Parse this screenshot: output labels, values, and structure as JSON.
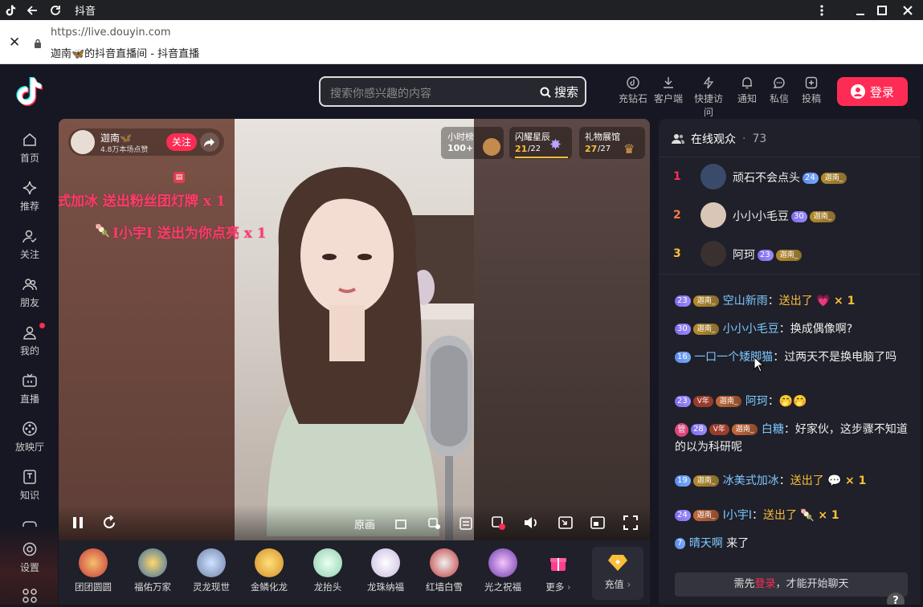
{
  "window": {
    "title": "抖音"
  },
  "urlbar": {
    "url": "https://live.douyin.com",
    "page_title": "迦南🦋的抖音直播间 - 抖音直播"
  },
  "header": {
    "search_placeholder": "搜索你感兴趣的内容",
    "search_button": "搜索",
    "items": [
      "充钻石",
      "客户端",
      "快捷访问",
      "通知",
      "私信",
      "投稿"
    ],
    "login": "登录"
  },
  "sidebar": {
    "items": [
      "首页",
      "推荐",
      "关注",
      "朋友",
      "我的",
      "直播",
      "放映厅",
      "知识",
      "设置"
    ]
  },
  "stream": {
    "anchor_name": "迦南🦋",
    "anchor_likes": "4.8万本场点赞",
    "follow": "关注",
    "hourly": {
      "label": "小时榜",
      "value": "100+"
    },
    "star": {
      "label": "闪耀星辰",
      "value": "21",
      "total": "/22"
    },
    "gallery": {
      "label": "礼物展馆",
      "value": "27",
      "total": "/27"
    },
    "float1": "式加冰 送出粉丝团灯牌 x 1",
    "float2": "I小宇I 送出为你点亮 x 1",
    "quality": "原画"
  },
  "gifts": {
    "items": [
      "团团圆圆",
      "福佑万家",
      "灵龙现世",
      "金鳞化龙",
      "龙抬头",
      "龙珠纳福",
      "红墙白雪",
      "光之祝福"
    ],
    "more": "更多",
    "recharge": "充值"
  },
  "audience": {
    "title": "在线观众",
    "count": "73",
    "ranks": [
      {
        "num": "1",
        "name": "顽石不会点头",
        "level": "24",
        "fan": "迦南_"
      },
      {
        "num": "2",
        "name": "小小小毛豆",
        "level": "30",
        "fan": "迦南_"
      },
      {
        "num": "3",
        "name": "阿珂",
        "level": "23",
        "fan": "迦南_"
      }
    ]
  },
  "chat": {
    "messages": [
      {
        "level": "23",
        "fan": "迦南_",
        "user": "空山新雨",
        "sent": "送出了",
        "count": "× 1"
      },
      {
        "level": "30",
        "fan": "迦南_",
        "user": "小小小毛豆",
        "text": "换成偶像啊?"
      },
      {
        "level": "16",
        "user": "一口一个矮脚猫",
        "text": "过两天不是换电脑了吗"
      },
      {
        "level": "23",
        "year": "V年",
        "fan": "迦南_",
        "user": "阿珂",
        "text": "🤭🤭"
      },
      {
        "guan": "管",
        "level": "28",
        "year": "V年",
        "fan": "迦南_",
        "user": "白糖",
        "text": "好家伙，这步骤不知道的以为科研呢"
      },
      {
        "level": "19",
        "fan": "迦南_",
        "user": "冰美式加冰",
        "sent": "送出了",
        "count": "× 1"
      },
      {
        "level": "24",
        "fan": "迦南_",
        "user": "I小宇I",
        "sent": "送出了",
        "count": "× 1"
      },
      {
        "level": "7",
        "user": "晴天啊",
        "text": "来了"
      }
    ],
    "input_prefix": "需先",
    "input_login": "登录",
    "input_suffix": "，才能开始聊天"
  },
  "colors": {
    "accent": "#fe2c55",
    "bg": "#161722",
    "panel": "#1f2029",
    "username": "#7ec7ff",
    "gift": "#fcbe3a"
  }
}
